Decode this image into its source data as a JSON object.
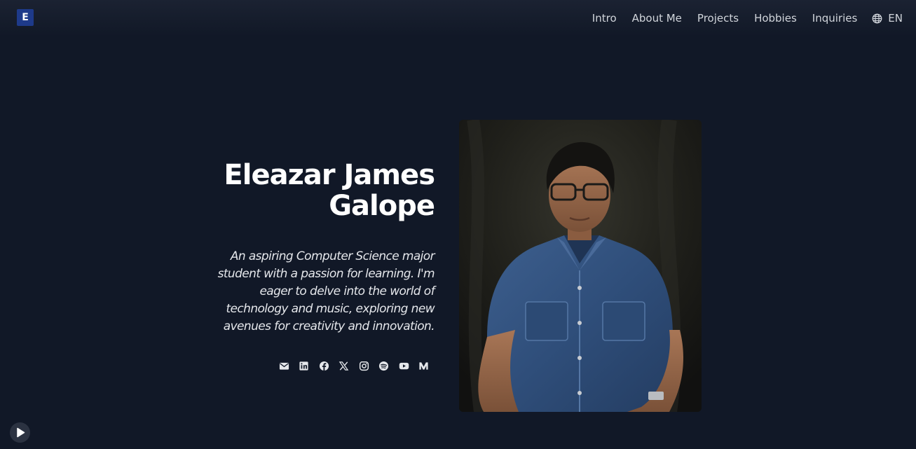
{
  "logo": {
    "letter": "E"
  },
  "nav": {
    "items": [
      {
        "label": "Intro"
      },
      {
        "label": "About Me"
      },
      {
        "label": "Projects"
      },
      {
        "label": "Hobbies"
      },
      {
        "label": "Inquiries"
      }
    ],
    "language": {
      "label": "EN",
      "icon": "globe-icon"
    }
  },
  "hero": {
    "name_line1": "Eleazar James",
    "name_line2": "Galope",
    "tagline": "An aspiring Computer Science major student with a passion for learning. I'm eager to delve into the world of technology and music, exploring new avenues for creativity and innovation."
  },
  "socials": [
    {
      "icon": "email-icon"
    },
    {
      "icon": "linkedin-icon"
    },
    {
      "icon": "facebook-icon"
    },
    {
      "icon": "x-icon"
    },
    {
      "icon": "instagram-icon"
    },
    {
      "icon": "spotify-icon"
    },
    {
      "icon": "youtube-icon"
    },
    {
      "icon": "medium-icon"
    }
  ],
  "player": {
    "icon": "play-icon"
  },
  "colors": {
    "background": "#111827",
    "logo_bg": "#1e3a8a",
    "text": "#e5e7eb",
    "heading": "#ffffff"
  }
}
